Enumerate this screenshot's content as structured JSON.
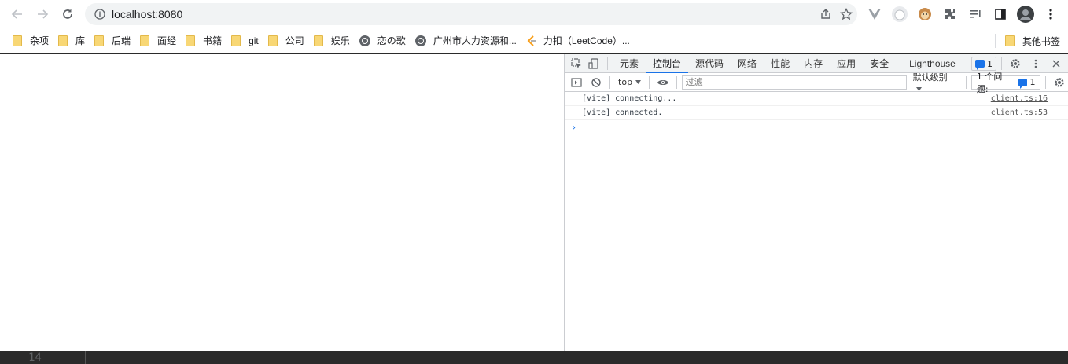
{
  "toolbar": {
    "url": "localhost:8080"
  },
  "bookmarks": [
    {
      "type": "folder",
      "label": "杂项"
    },
    {
      "type": "folder",
      "label": "库"
    },
    {
      "type": "folder",
      "label": "后端"
    },
    {
      "type": "folder",
      "label": "面经"
    },
    {
      "type": "folder",
      "label": "书籍"
    },
    {
      "type": "folder",
      "label": "git"
    },
    {
      "type": "folder",
      "label": "公司"
    },
    {
      "type": "folder",
      "label": "娱乐"
    },
    {
      "type": "site",
      "label": "恋の歌"
    },
    {
      "type": "site",
      "label": "广州市人力资源和..."
    },
    {
      "type": "site",
      "label": "力扣（LeetCode）..."
    }
  ],
  "bookmarks_other": "其他书签",
  "devtools": {
    "tabs": [
      "元素",
      "控制台",
      "源代码",
      "网络",
      "性能",
      "内存",
      "应用",
      "安全",
      "Lighthouse"
    ],
    "active_tab": "控制台",
    "message_count": "1",
    "context": "top",
    "filter_placeholder": "过滤",
    "levels": "默认级别",
    "issues_label": "1 个问题:",
    "issues_count": "1",
    "console_rows": [
      {
        "message": "[vite] connecting...",
        "source": "client.ts:16"
      },
      {
        "message": "[vite] connected.",
        "source": "client.ts:53"
      }
    ],
    "prompt": "›"
  },
  "editor": {
    "line_number": "14"
  },
  "colors": {
    "accent": "#1a73e8",
    "folder": "#f8d775"
  }
}
